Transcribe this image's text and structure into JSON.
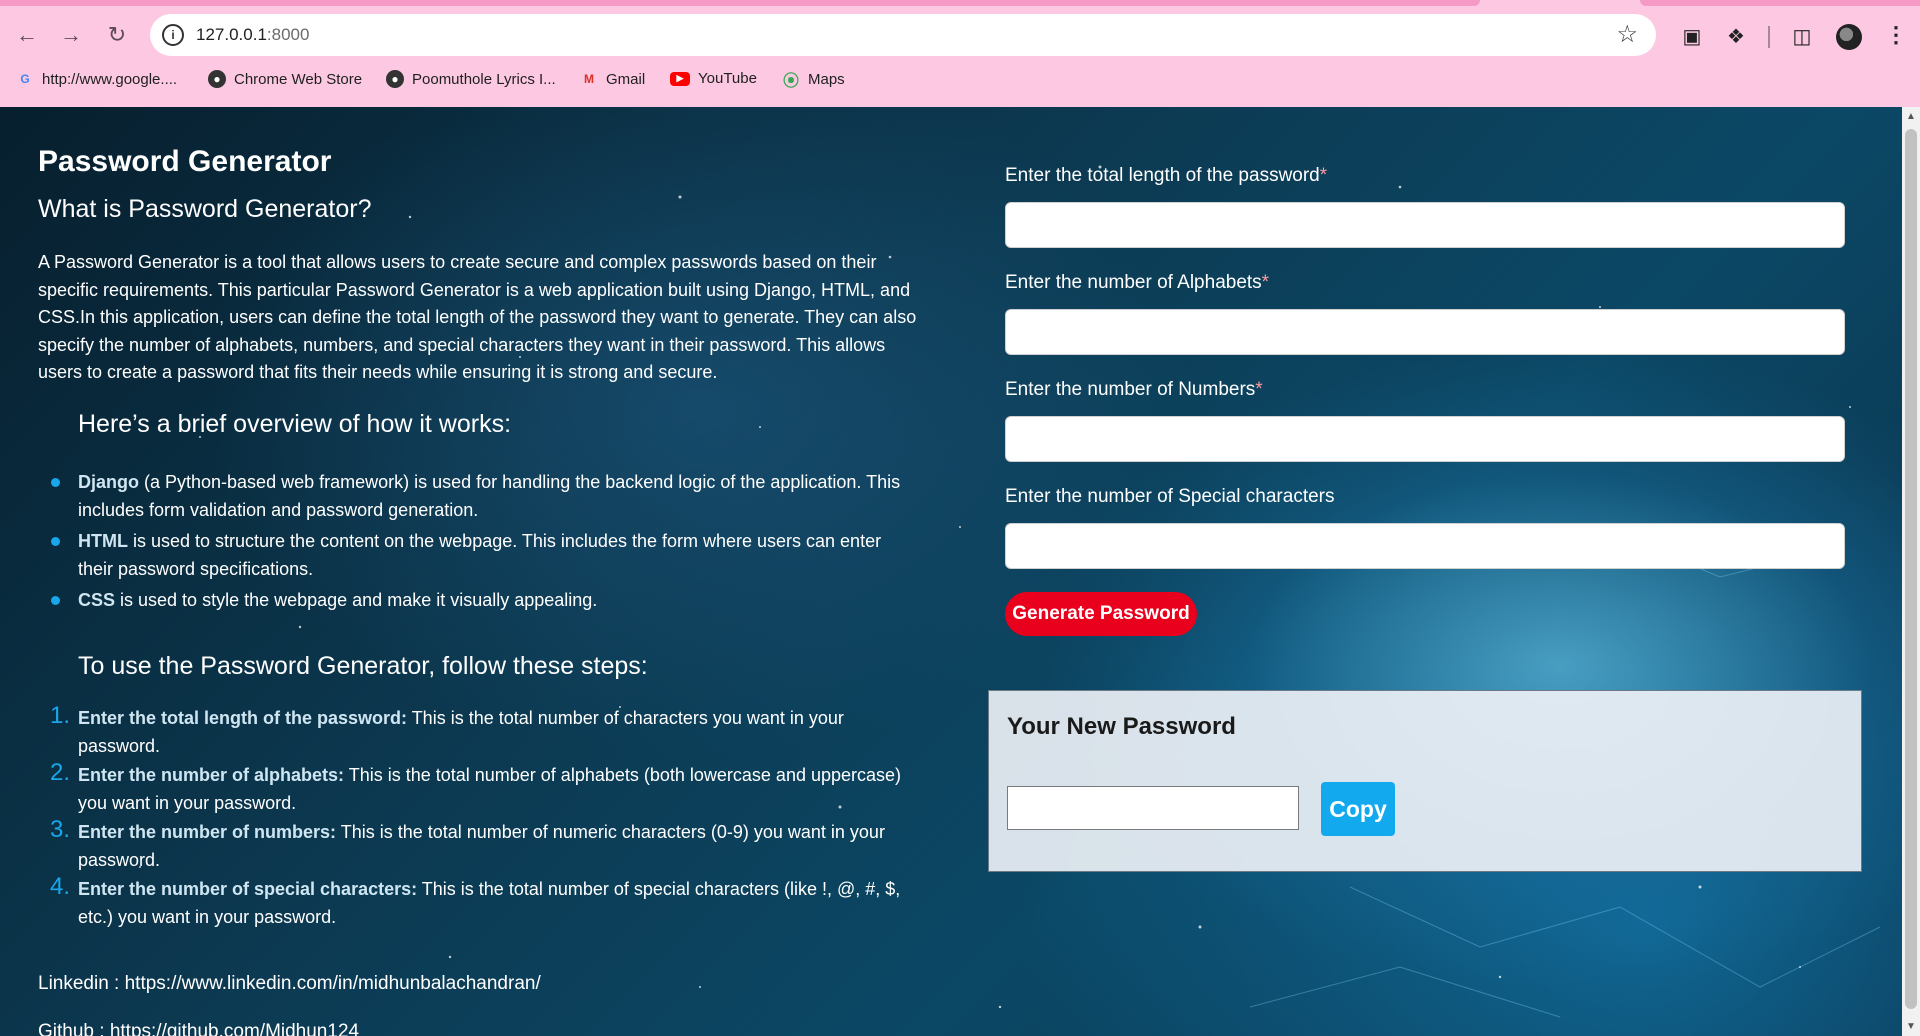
{
  "browser": {
    "url_host": "127.0.0.1",
    "url_port": ":8000",
    "bookmarks": [
      {
        "label": "http://www.google...."
      },
      {
        "label": "Chrome Web Store"
      },
      {
        "label": "Poomuthole Lyrics I..."
      },
      {
        "label": "Gmail"
      },
      {
        "label": "YouTube"
      },
      {
        "label": "Maps"
      }
    ]
  },
  "page": {
    "title": "Password Generator",
    "subtitle": "What is Password Generator?",
    "intro": "A Password Generator is a tool that allows users to create secure and complex passwords based on their specific requirements. This particular Password Generator is a web application built using Django, HTML, and CSS.In this application, users can define the total length of the password they want to generate. They can also specify the number of alphabets, numbers, and special characters they want in their password. This allows users to create a password that fits their needs while ensuring it is strong and secure.",
    "overview_heading": "Here’s a brief overview of how it works:",
    "overview": [
      {
        "term": "Django",
        "text": " (a Python-based web framework) is used for handling the backend logic of the application. This includes form validation and password generation."
      },
      {
        "term": "HTML",
        "text": " is used to structure the content on the webpage. This includes the form where users can enter their password specifications."
      },
      {
        "term": "CSS",
        "text": " is used to style the webpage and make it visually appealing."
      }
    ],
    "steps_heading": "To use the Password Generator, follow these steps:",
    "steps": [
      {
        "num": "1.",
        "term": "Enter the total length of the password:",
        "text": " This is the total number of characters you want in your password."
      },
      {
        "num": "2.",
        "term": "Enter the number of alphabets:",
        "text": " This is the total number of alphabets (both lowercase and uppercase) you want in your password."
      },
      {
        "num": "3.",
        "term": "Enter the number of numbers:",
        "text": " This is the total number of numeric characters (0-9) you want in your password."
      },
      {
        "num": "4.",
        "term": "Enter the number of special characters:",
        "text": " This is the total number of special characters (like !, @, #, $, etc.) you want in your password."
      }
    ],
    "linkedin": "Linkedin : https://www.linkedin.com/in/midhunbalachandran/",
    "github": "Github : https://github.com/Midhun124"
  },
  "form": {
    "length_label": "Enter the total length of the password",
    "alphabets_label": "Enter the number of Alphabets",
    "numbers_label": "Enter the number of Numbers",
    "special_label": "Enter the number of Special characters",
    "required_mark": "*",
    "length_value": "",
    "alphabets_value": "",
    "numbers_value": "",
    "special_value": "",
    "generate_label": "Generate Password"
  },
  "result": {
    "title": "Your New Password",
    "value": "",
    "copy_label": "Copy"
  },
  "colors": {
    "chrome_bg": "#fcc8e2",
    "accent_blue": "#19a6ea",
    "generate_red": "#e8001c",
    "copy_blue": "#12a9ee"
  }
}
